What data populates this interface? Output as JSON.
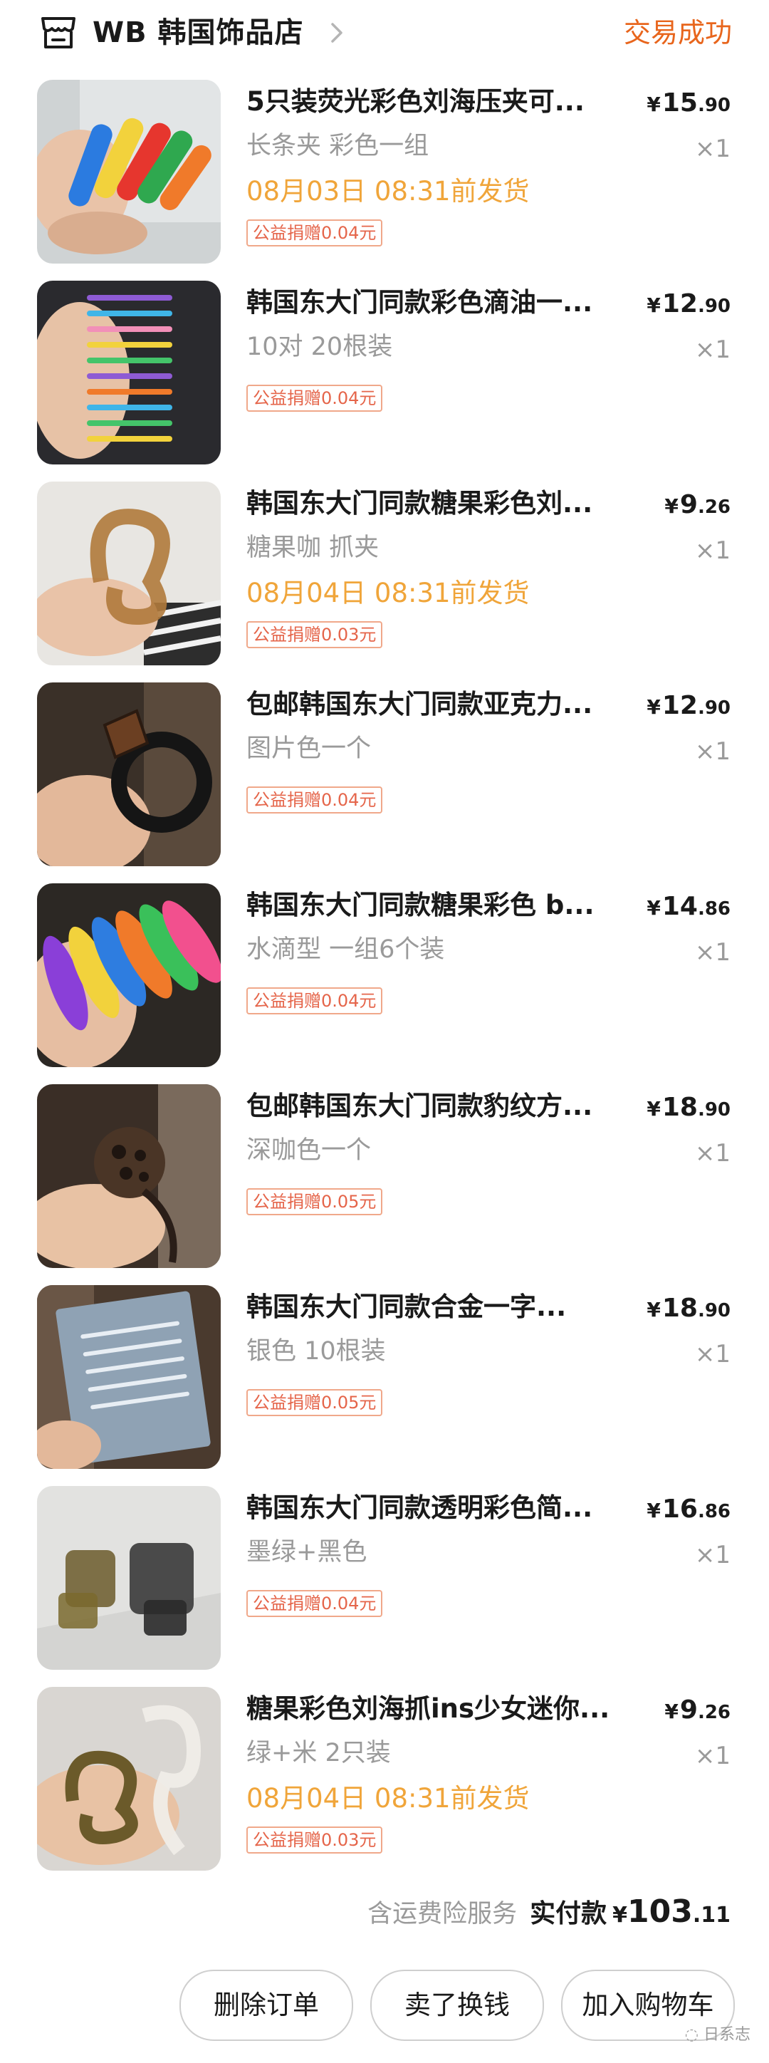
{
  "shop": {
    "name": "WB 韩国饰品店",
    "icon": "store-icon",
    "status": "交易成功"
  },
  "items": [
    {
      "title": "5只装荧光彩色刘海压夹可...",
      "price_currency": "¥",
      "price_int": "15",
      "price_dec": ".90",
      "sku": "长条夹 彩色一组",
      "qty": "×1",
      "ship": "08月03日 08:31前发货",
      "donation": "公益捐赠0.04元"
    },
    {
      "title": "韩国东大门同款彩色滴油一...",
      "price_currency": "¥",
      "price_int": "12",
      "price_dec": ".90",
      "sku": "10对 20根装",
      "qty": "×1",
      "ship": "",
      "donation": "公益捐赠0.04元"
    },
    {
      "title": "韩国东大门同款糖果彩色刘...",
      "price_currency": "¥",
      "price_int": "9",
      "price_dec": ".26",
      "sku": "糖果咖 抓夹",
      "qty": "×1",
      "ship": "08月04日 08:31前发货",
      "donation": "公益捐赠0.03元"
    },
    {
      "title": "包邮韩国东大门同款亚克力...",
      "price_currency": "¥",
      "price_int": "12",
      "price_dec": ".90",
      "sku": "图片色一个",
      "qty": "×1",
      "ship": "",
      "donation": "公益捐赠0.04元"
    },
    {
      "title": "韩国东大门同款糖果彩色 b...",
      "price_currency": "¥",
      "price_int": "14",
      "price_dec": ".86",
      "sku": "水滴型 一组6个装",
      "qty": "×1",
      "ship": "",
      "donation": "公益捐赠0.04元"
    },
    {
      "title": "包邮韩国东大门同款豹纹方...",
      "price_currency": "¥",
      "price_int": "18",
      "price_dec": ".90",
      "sku": "深咖色一个",
      "qty": "×1",
      "ship": "",
      "donation": "公益捐赠0.05元"
    },
    {
      "title": "韩国东大门同款合金一字...",
      "price_currency": "¥",
      "price_int": "18",
      "price_dec": ".90",
      "sku": "银色 10根装",
      "qty": "×1",
      "ship": "",
      "donation": "公益捐赠0.05元"
    },
    {
      "title": "韩国东大门同款透明彩色简...",
      "price_currency": "¥",
      "price_int": "16",
      "price_dec": ".86",
      "sku": "墨绿+黑色",
      "qty": "×1",
      "ship": "",
      "donation": "公益捐赠0.04元"
    },
    {
      "title": "糖果彩色刘海抓ins少女迷你...",
      "price_currency": "¥",
      "price_int": "9",
      "price_dec": ".26",
      "sku": "绿+米 2只装",
      "qty": "×1",
      "ship": "08月04日 08:31前发货",
      "donation": "公益捐赠0.03元"
    }
  ],
  "summary": {
    "service_note": "含运费险服务",
    "label": "实付款",
    "currency": "¥",
    "total_int": "103",
    "total_dec": ".11"
  },
  "actions": {
    "delete": "删除订单",
    "resell": "卖了换钱",
    "add_cart": "加入购物车"
  },
  "watermark": "日系志",
  "colors": {
    "accent": "#e8651c",
    "ship": "#f0a53a",
    "donation": "#e5654a"
  }
}
